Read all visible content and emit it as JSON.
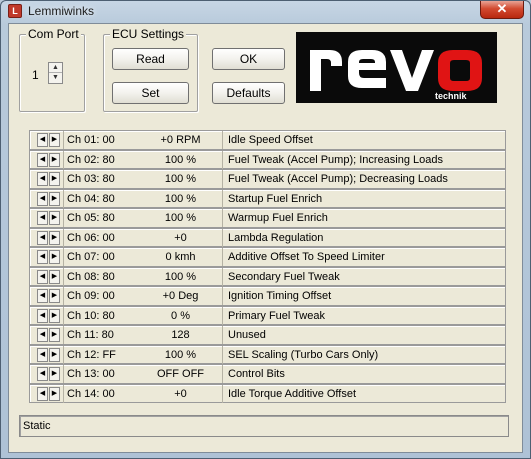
{
  "window": {
    "title": "Lemmiwinks",
    "close_label": "✕",
    "app_icon_letter": "L"
  },
  "com_port": {
    "label": "Com Port",
    "value": "1"
  },
  "ecu_settings": {
    "label": "ECU Settings",
    "read_label": "Read",
    "set_label": "Set"
  },
  "actions": {
    "ok_label": "OK",
    "defaults_label": "Defaults"
  },
  "logo": {
    "brand": "revo",
    "sub": "technik",
    "accent": "#e01414"
  },
  "channels": [
    {
      "ch": "Ch 01: 00",
      "value": "+0 RPM",
      "desc": "Idle Speed Offset"
    },
    {
      "ch": "Ch 02: 80",
      "value": "100 %",
      "desc": "Fuel Tweak (Accel Pump); Increasing Loads"
    },
    {
      "ch": "Ch 03: 80",
      "value": "100 %",
      "desc": "Fuel Tweak (Accel Pump); Decreasing Loads"
    },
    {
      "ch": "Ch 04: 80",
      "value": "100 %",
      "desc": "Startup Fuel Enrich"
    },
    {
      "ch": "Ch 05: 80",
      "value": "100 %",
      "desc": "Warmup Fuel Enrich"
    },
    {
      "ch": "Ch 06: 00",
      "value": "+0",
      "desc": "Lambda Regulation"
    },
    {
      "ch": "Ch 07: 00",
      "value": "0 kmh",
      "desc": "Additive Offset To Speed Limiter"
    },
    {
      "ch": "Ch 08: 80",
      "value": "100 %",
      "desc": "Secondary Fuel Tweak"
    },
    {
      "ch": "Ch 09: 00",
      "value": "+0 Deg",
      "desc": "Ignition Timing Offset"
    },
    {
      "ch": "Ch 10: 80",
      "value": "0 %",
      "desc": "Primary Fuel Tweak"
    },
    {
      "ch": "Ch 11: 80",
      "value": "128",
      "desc": "Unused"
    },
    {
      "ch": "Ch 12: FF",
      "value": "100 %",
      "desc": "SEL Scaling (Turbo Cars Only)"
    },
    {
      "ch": "Ch 13: 00",
      "value": "OFF  OFF",
      "desc": "Control Bits"
    },
    {
      "ch": "Ch 14: 00",
      "value": "+0",
      "desc": "Idle Torque Additive Offset"
    }
  ],
  "status": {
    "text": "Static"
  },
  "icons": {
    "left": "arrow-left-icon",
    "right": "arrow-right-icon",
    "up": "spin-up-icon",
    "down": "spin-down-icon"
  }
}
